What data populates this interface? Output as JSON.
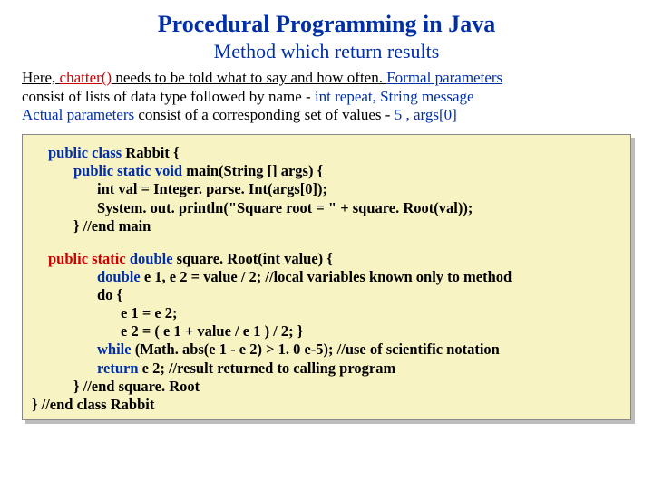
{
  "heading": {
    "title": "Procedural Programming in Java",
    "subtitle": "Method which return results"
  },
  "intro": {
    "p1a": "Here, ",
    "p1b": "chatter()",
    "p1c": " needs to be told what to say and how often. ",
    "p1d": "Formal parameters",
    "p2a": "consist of lists of  data type followed by name - ",
    "p2b": " int repeat, String message",
    "p3a": "Actual parameters",
    "p3b": " consist of a corresponding set of values - ",
    "p3c": "5 , args[0]"
  },
  "code": {
    "l01a": "public class",
    "l01b": "  Rabbit {",
    "l02a": "public static void",
    "l02b": " main(String [] args) {",
    "l03": "int val = Integer. parse. Int(args[0]);",
    "l04": "System. out. println(\"Square root = \" + square. Root(val));",
    "l05": "} //end main",
    "l06a": "public static ",
    "l06b": "double",
    "l06c": " square. Root(int value) {",
    "l07a": "double",
    "l07b": " e 1, e 2 = value / 2;    //local variables known only to method",
    "l08": "do {",
    "l09": "e 1 = e 2;",
    "l10": "e 2 = ( e 1 + value / e 1 ) / 2; }",
    "l11a": "while",
    "l11b": " (Math. abs(e 1 - e 2) > 1. 0 e-5);   //use of scientific notation",
    "l12a": "return",
    "l12b": " e 2;   //result returned to calling program",
    "l13": "} //end square. Root",
    "l14": "} //end class Rabbit"
  }
}
